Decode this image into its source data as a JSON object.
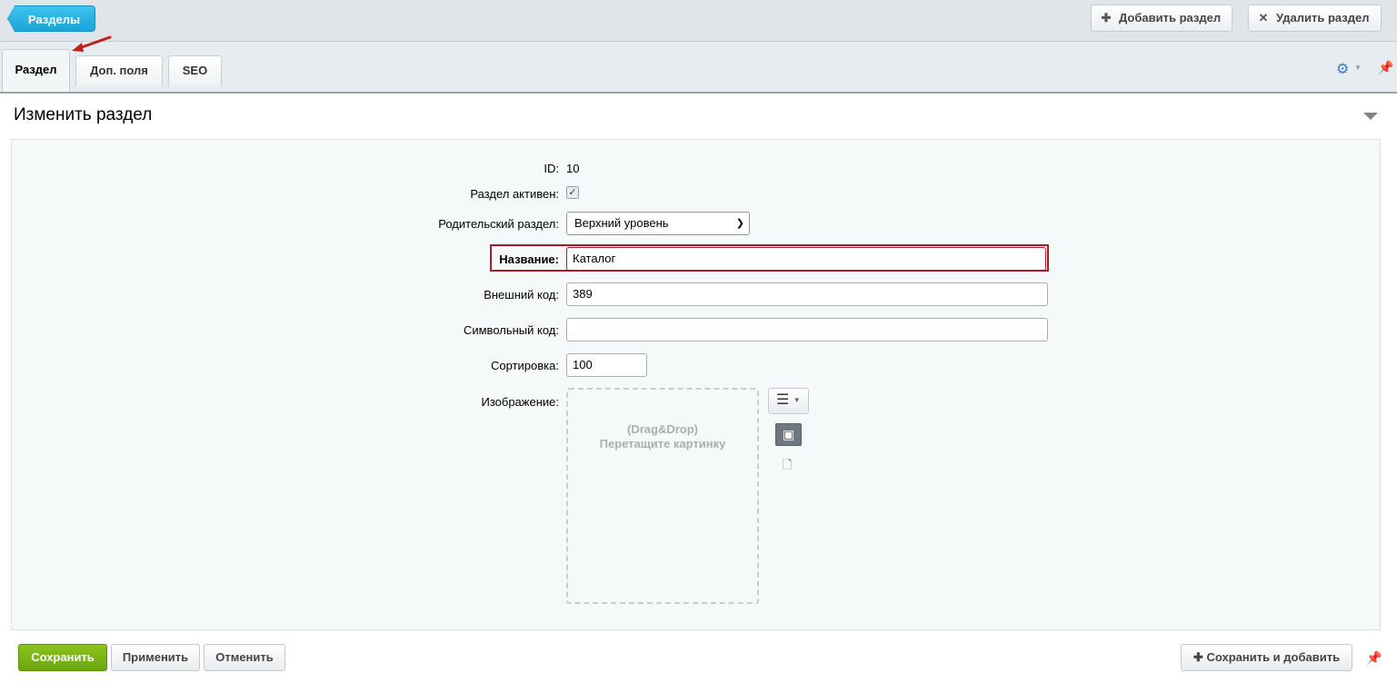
{
  "toolbar": {
    "back_label": "Разделы",
    "add_label": "Добавить раздел",
    "delete_label": "Удалить раздел",
    "add_icon": "plus-icon",
    "delete_icon": "close-icon"
  },
  "tabs": [
    {
      "label": "Раздел",
      "active": true
    },
    {
      "label": "Доп. поля",
      "active": false
    },
    {
      "label": "SEO",
      "active": false
    }
  ],
  "form": {
    "title": "Изменить раздел",
    "id_label": "ID:",
    "id_value": "10",
    "active_label": "Раздел активен:",
    "active_checked": true,
    "parent_label": "Родительский раздел:",
    "parent_value": "Верхний уровень",
    "name_label": "Название:",
    "name_value": "Каталог",
    "external_code_label": "Внешний код:",
    "external_code_value": "389",
    "symbol_code_label": "Символьный код:",
    "symbol_code_value": "",
    "sort_label": "Сортировка:",
    "sort_value": "100",
    "image_label": "Изображение:",
    "drop_line1": "(Drag&Drop)",
    "drop_line2": "Перетащите картинку"
  },
  "footer": {
    "save_label": "Сохранить",
    "apply_label": "Применить",
    "cancel_label": "Отменить",
    "save_add_label": "Сохранить и добавить"
  },
  "colors": {
    "accent_blue": "#1ba3d9",
    "save_green": "#6aa612",
    "highlight_red": "#a81e28"
  }
}
